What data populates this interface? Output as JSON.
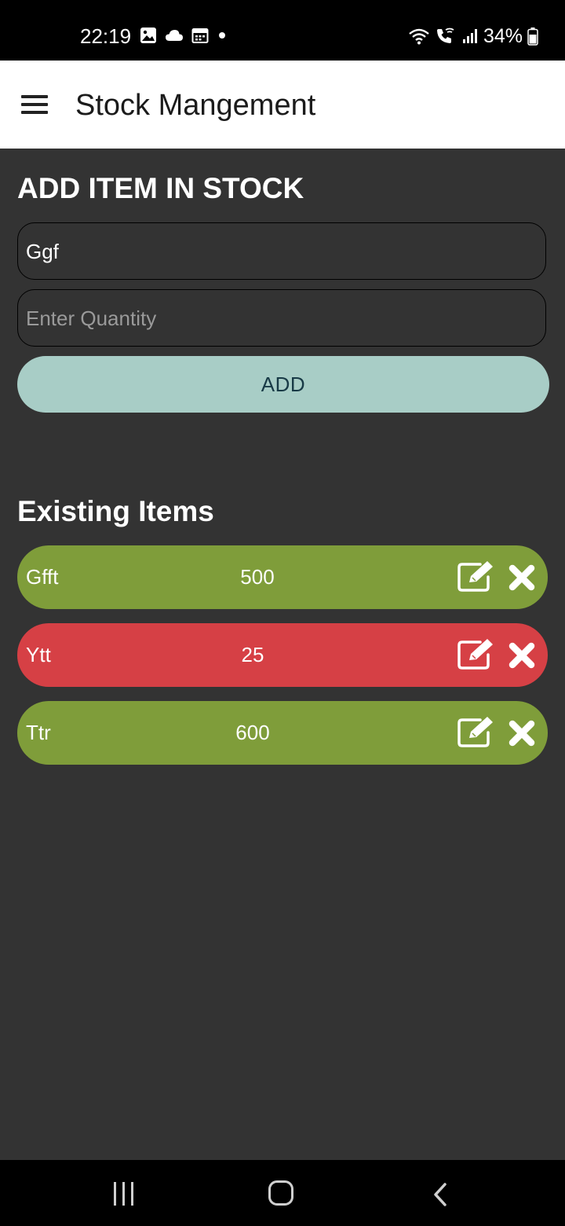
{
  "status_bar": {
    "time": "22:19",
    "battery": "34%",
    "icons": [
      "image-icon",
      "cloud-icon",
      "calendar-icon",
      "dot-icon",
      "wifi-icon",
      "wifi-call-icon",
      "signal-icon",
      "battery-icon"
    ]
  },
  "app_bar": {
    "title": "Stock Mangement",
    "menu_icon": "hamburger-menu-icon"
  },
  "add_section": {
    "title": "ADD ITEM IN STOCK",
    "name_input": {
      "value": "Ggf",
      "placeholder": ""
    },
    "quantity_input": {
      "value": "",
      "placeholder": "Enter Quantity"
    },
    "add_button": "ADD"
  },
  "existing_section": {
    "title": "Existing Items",
    "items": [
      {
        "name": "Gfft",
        "quantity": "500",
        "status_color": "#7f9d3a"
      },
      {
        "name": "Ytt",
        "quantity": "25",
        "status_color": "#d64045"
      },
      {
        "name": "Ttr",
        "quantity": "600",
        "status_color": "#7f9d3a"
      }
    ]
  },
  "colors": {
    "background": "#333333",
    "app_bar": "#ffffff",
    "add_button": "#a8cdc6",
    "in_stock": "#7f9d3a",
    "low_stock": "#d64045"
  }
}
